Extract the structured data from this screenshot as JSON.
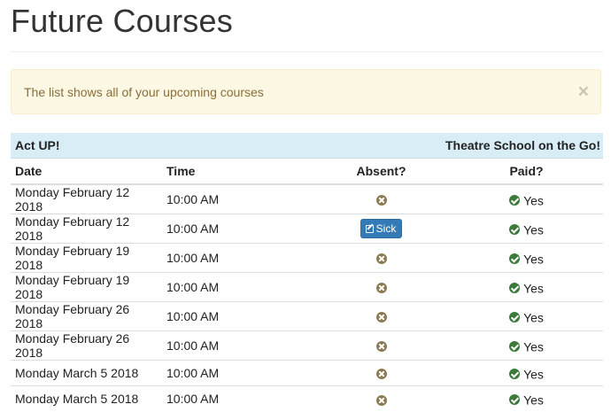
{
  "page": {
    "title": "Future Courses"
  },
  "alert": {
    "message": "The list shows all of your upcoming courses",
    "close_symbol": "×",
    "icon": "close-icon"
  },
  "course": {
    "name": "Act UP!",
    "provider": "Theatre School on the Go!"
  },
  "table": {
    "headers": {
      "date": "Date",
      "time": "Time",
      "absent": "Absent?",
      "paid": "Paid?"
    },
    "rows": [
      {
        "date": "Monday February 12 2018",
        "time": "10:00 AM",
        "absent": {
          "type": "icon",
          "icon": "remove-circle-icon"
        },
        "paid": "Yes"
      },
      {
        "date": "Monday February 12 2018",
        "time": "10:00 AM",
        "absent": {
          "type": "button",
          "label": "Sick",
          "icon": "edit-icon"
        },
        "paid": "Yes"
      },
      {
        "date": "Monday February 19 2018",
        "time": "10:00 AM",
        "absent": {
          "type": "icon",
          "icon": "remove-circle-icon"
        },
        "paid": "Yes"
      },
      {
        "date": "Monday February 19 2018",
        "time": "10:00 AM",
        "absent": {
          "type": "icon",
          "icon": "remove-circle-icon"
        },
        "paid": "Yes"
      },
      {
        "date": "Monday February 26 2018",
        "time": "10:00 AM",
        "absent": {
          "type": "icon",
          "icon": "remove-circle-icon"
        },
        "paid": "Yes"
      },
      {
        "date": "Monday February 26 2018",
        "time": "10:00 AM",
        "absent": {
          "type": "icon",
          "icon": "remove-circle-icon"
        },
        "paid": "Yes"
      },
      {
        "date": "Monday March 5 2018",
        "time": "10:00 AM",
        "absent": {
          "type": "icon",
          "icon": "remove-circle-icon"
        },
        "paid": "Yes"
      },
      {
        "date": "Monday March 5 2018",
        "time": "10:00 AM",
        "absent": {
          "type": "icon",
          "icon": "remove-circle-icon"
        },
        "paid": "Yes"
      }
    ],
    "paid_icon": "ok-circle-icon"
  },
  "colors": {
    "alert_background": "#fcf8e3",
    "alert_text": "#8a6d3b",
    "course_header_background": "#d9edf7",
    "sick_button": "#337ab7",
    "paid_icon": "#3c7a3c",
    "absent_icon": "#8c7b54"
  }
}
